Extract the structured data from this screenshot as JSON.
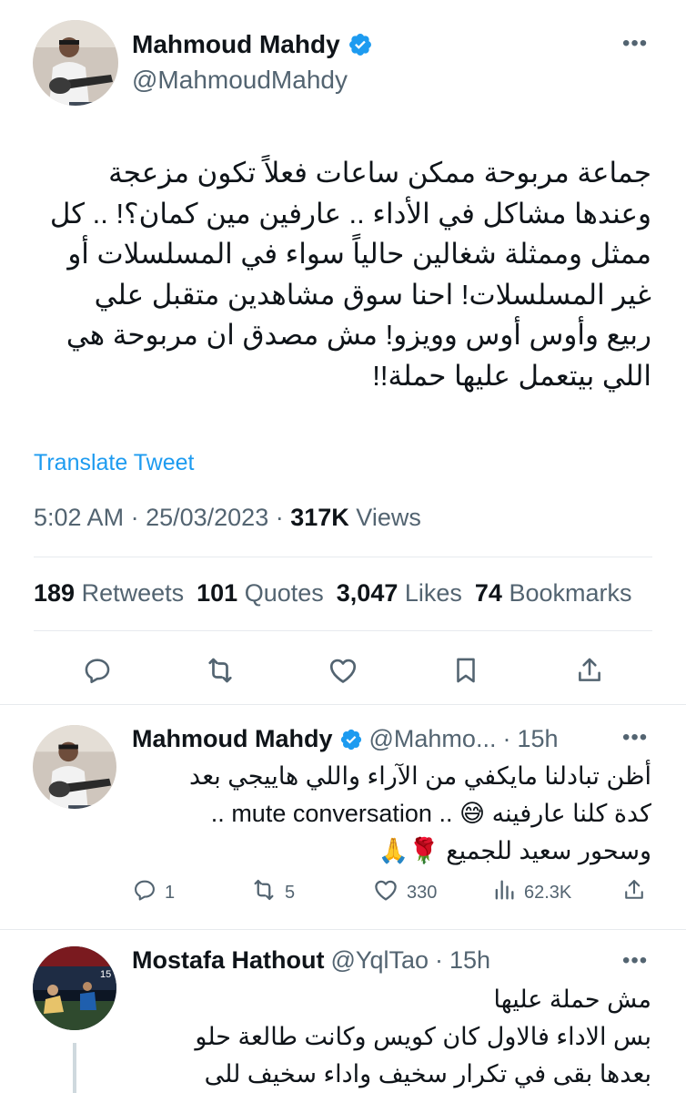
{
  "main_tweet": {
    "author_name": "Mahmoud Mahdy",
    "handle": "@MahmoudMahdy",
    "text_lines": [
      "جماعة مربوحة ممكن ساعات فعلاً تكون مزعجة",
      "وعندها مشاكل في الأداء .. عارفين مين كمان؟! .. كل",
      "ممثل وممثلة شغالين حالياً سواء في المسلسلات أو",
      "غير المسلسلات! احنا سوق مشاهدين متقبل علي",
      "ربيع وأوس أوس وويزو! مش مصدق ان مربوحة هي",
      "اللي بيتعمل عليها حملة!!"
    ],
    "translate_label": "Translate Tweet",
    "time": "5:02 AM",
    "date": "25/03/2023",
    "views_count": "317K",
    "views_label": "Views",
    "stats": {
      "retweets_count": "189",
      "retweets_label": "Retweets",
      "quotes_count": "101",
      "quotes_label": "Quotes",
      "likes_count": "3,047",
      "likes_label": "Likes",
      "bookmarks_count": "74",
      "bookmarks_label": "Bookmarks"
    },
    "actions": [
      "reply-icon",
      "retweet-icon",
      "like-icon",
      "bookmark-icon",
      "share-icon"
    ]
  },
  "replies": [
    {
      "author_name": "Mahmoud Mahdy",
      "handle": "@Mahmo...",
      "separator": "·",
      "time": "15h",
      "verified": true,
      "text_lines": [
        "أظن تبادلنا مايكفي من الآراء واللي هاييجي بعد",
        "كدة كلنا عارفينه 😅 .. mute conversation ..",
        "وسحور سعيد للجميع 🌹🙏"
      ],
      "actions": {
        "reply_count": "1",
        "retweet_count": "5",
        "like_count": "330",
        "views_count": "62.3K"
      }
    },
    {
      "author_name": "Mostafa Hathout",
      "handle": "@YqlTao",
      "separator": "·",
      "time": "15h",
      "verified": false,
      "text_lines": [
        "مش حملة عليها",
        "بس الاداء فالاول كان كويس  وكانت طالعة حلو",
        "بعدها بقى في تكرار سخيف واداء سخيف للى"
      ]
    }
  ],
  "colors": {
    "link_blue": "#1d9bf0",
    "secondary_text": "#536471",
    "primary_text": "#0f1419",
    "divider": "#e7eaee"
  }
}
